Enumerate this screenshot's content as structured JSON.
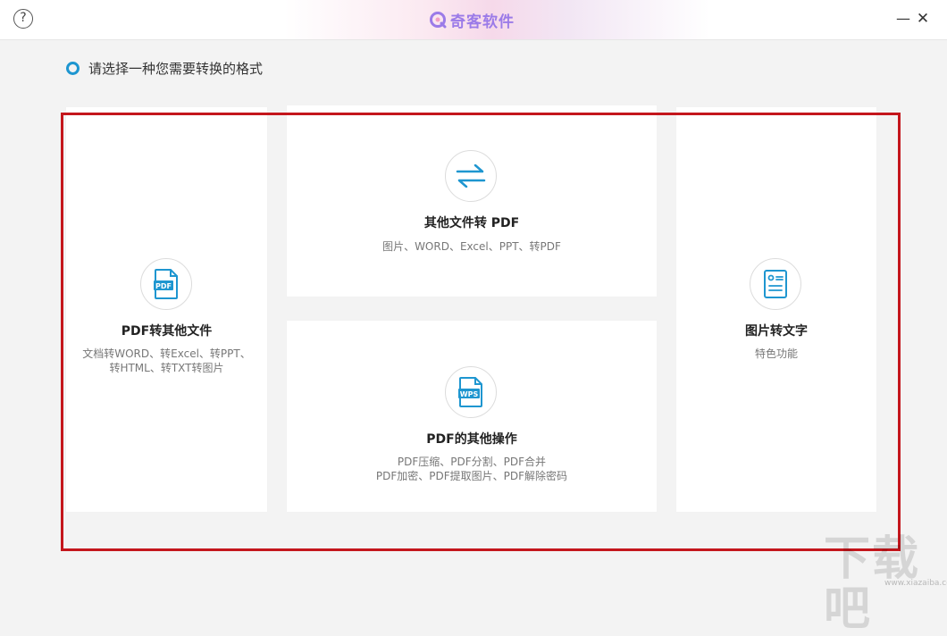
{
  "titlebar": {
    "help_label": "?",
    "brand_name": "奇客软件",
    "brand_color": "#9b7be8",
    "minimize_label": "—",
    "close_label": "✕"
  },
  "prompt": {
    "text": "请选择一种您需要转换的格式"
  },
  "accent_color": "#1e96d0",
  "highlight_color": "#c4161c",
  "cards": [
    {
      "id": "pdf-to-other",
      "icon": "pdf-file-icon",
      "title": "PDF转其他文件",
      "desc_line1": "文档转WORD、转Excel、转PPT、",
      "desc_line2": "转HTML、转TXT转图片"
    },
    {
      "id": "other-to-pdf",
      "icon": "convert-arrows-icon",
      "title": "其他文件转 PDF",
      "desc_line1": "图片、WORD、Excel、PPT、转PDF"
    },
    {
      "id": "pdf-other-ops",
      "icon": "wps-file-icon",
      "title": "PDF的其他操作",
      "desc_line1": "PDF压缩、PDF分割、PDF合并",
      "desc_line2": "PDF加密、PDF提取图片、PDF解除密码"
    },
    {
      "id": "image-to-text",
      "icon": "image-text-icon",
      "title": "图片转文字",
      "desc_line1": "特色功能"
    }
  ],
  "watermark": {
    "text": "下载吧",
    "url": "www.xiazaiba.com"
  }
}
